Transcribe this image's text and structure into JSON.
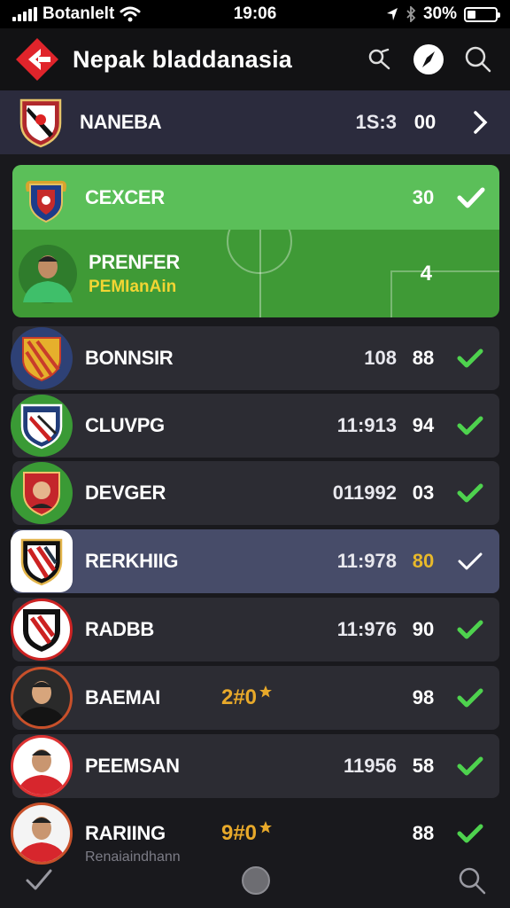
{
  "status_bar": {
    "carrier": "Botanlelt",
    "time": "19:06",
    "battery": "30%",
    "battery_level": 0.3
  },
  "header": {
    "title": "Nepak bladdanasia"
  },
  "top_team": {
    "name": "NANEBA",
    "time": "1S:3",
    "score": "00"
  },
  "highlight": {
    "team": {
      "name": "CEXCER",
      "score": "30"
    },
    "player": {
      "name": "PRENFER",
      "position": "PEMIanAin",
      "number": "4"
    }
  },
  "rows": [
    {
      "name": "BONNSIR",
      "time": "108",
      "score": "88"
    },
    {
      "name": "CLUVPG",
      "time": "11:913",
      "score": "94"
    },
    {
      "name": "DEVGER",
      "time": "011992",
      "score": "03"
    },
    {
      "name": "RERKHIIG",
      "time": "11:978",
      "score": "80"
    },
    {
      "name": "RADBB",
      "time": "11:976",
      "score": "90"
    },
    {
      "name": "BAEMAI",
      "badge": "2#0",
      "score": "98"
    },
    {
      "name": "PEEMSAN",
      "time": "11956",
      "score": "58"
    },
    {
      "name": "RARIING",
      "badge": "9#0",
      "score": "88"
    }
  ],
  "footer_subtext": "Renaiaindhann",
  "colors": {
    "accent_green": "#5bbf59",
    "check_green": "#4ed24e",
    "gold": "#e8a92a",
    "selected_row": "#474c69"
  },
  "icons": [
    "signal-icon",
    "wifi-icon",
    "location-icon",
    "bluetooth-icon",
    "battery-icon",
    "logo-icon",
    "search-alt-icon",
    "compass-icon",
    "search-icon",
    "chevron-right-icon",
    "check-icon",
    "star-icon",
    "home-icon"
  ]
}
